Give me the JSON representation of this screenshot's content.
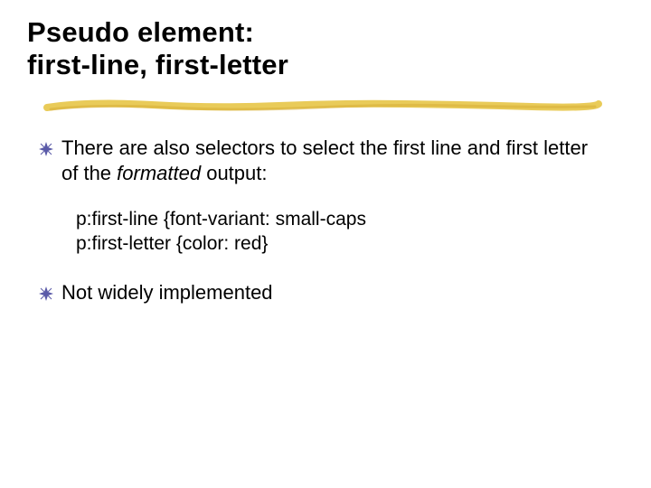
{
  "title": {
    "line1": "Pseudo element:",
    "line2": "first-line, first-letter"
  },
  "bullets": [
    {
      "partA": "There are also selectors to select the first line and first letter of the ",
      "italic": "formatted",
      "partB": " output:"
    },
    {
      "text": "Not widely implemented"
    }
  ],
  "code": {
    "line1": "p:first-line {font-variant: small-caps",
    "line2": "p:first-letter {color: red}"
  }
}
